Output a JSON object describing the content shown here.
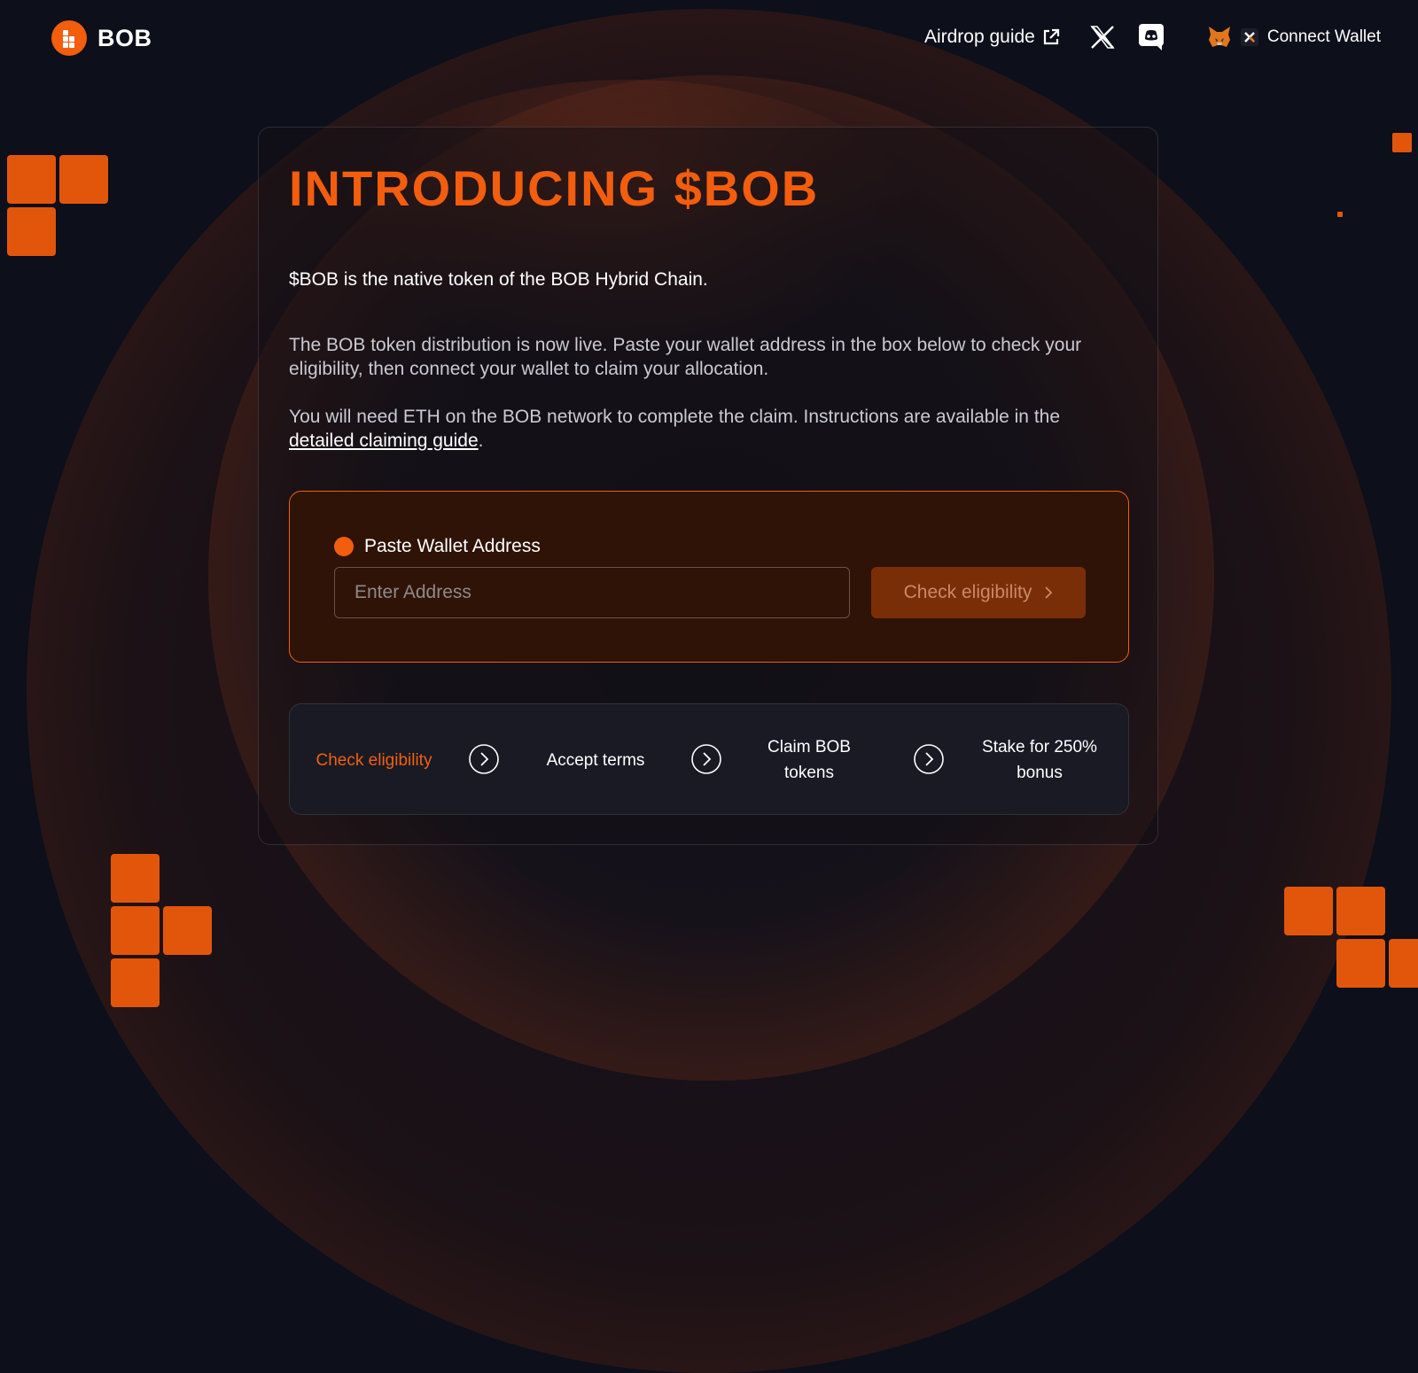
{
  "header": {
    "brand": "BOB",
    "airdrop_guide": "Airdrop guide",
    "connect_wallet": "Connect Wallet"
  },
  "card": {
    "title": "INTRODUCING $BOB",
    "intro": "$BOB is the native token of the BOB Hybrid Chain.",
    "description": "The BOB token distribution is now live. Paste your wallet address in the box below to check your eligibility, then connect your wallet to claim your allocation.",
    "claim_text_prefix": "You will need ETH on the BOB network to complete the claim. Instructions are available in the ",
    "claim_link": "detailed claiming guide",
    "claim_text_suffix": "."
  },
  "wallet": {
    "label": "Paste Wallet Address",
    "placeholder": "Enter Address",
    "value": "",
    "check_button": "Check eligibility"
  },
  "steps": [
    {
      "label": "Check eligibility",
      "active": true
    },
    {
      "label": "Accept terms",
      "active": false
    },
    {
      "label": "Claim BOB tokens",
      "active": false
    },
    {
      "label": "Stake for 250% bonus",
      "active": false
    }
  ],
  "colors": {
    "accent": "#f25d0e",
    "background": "#0d0f1a",
    "wallet_box": "#2e1306",
    "button_bg": "#7a2e07"
  }
}
